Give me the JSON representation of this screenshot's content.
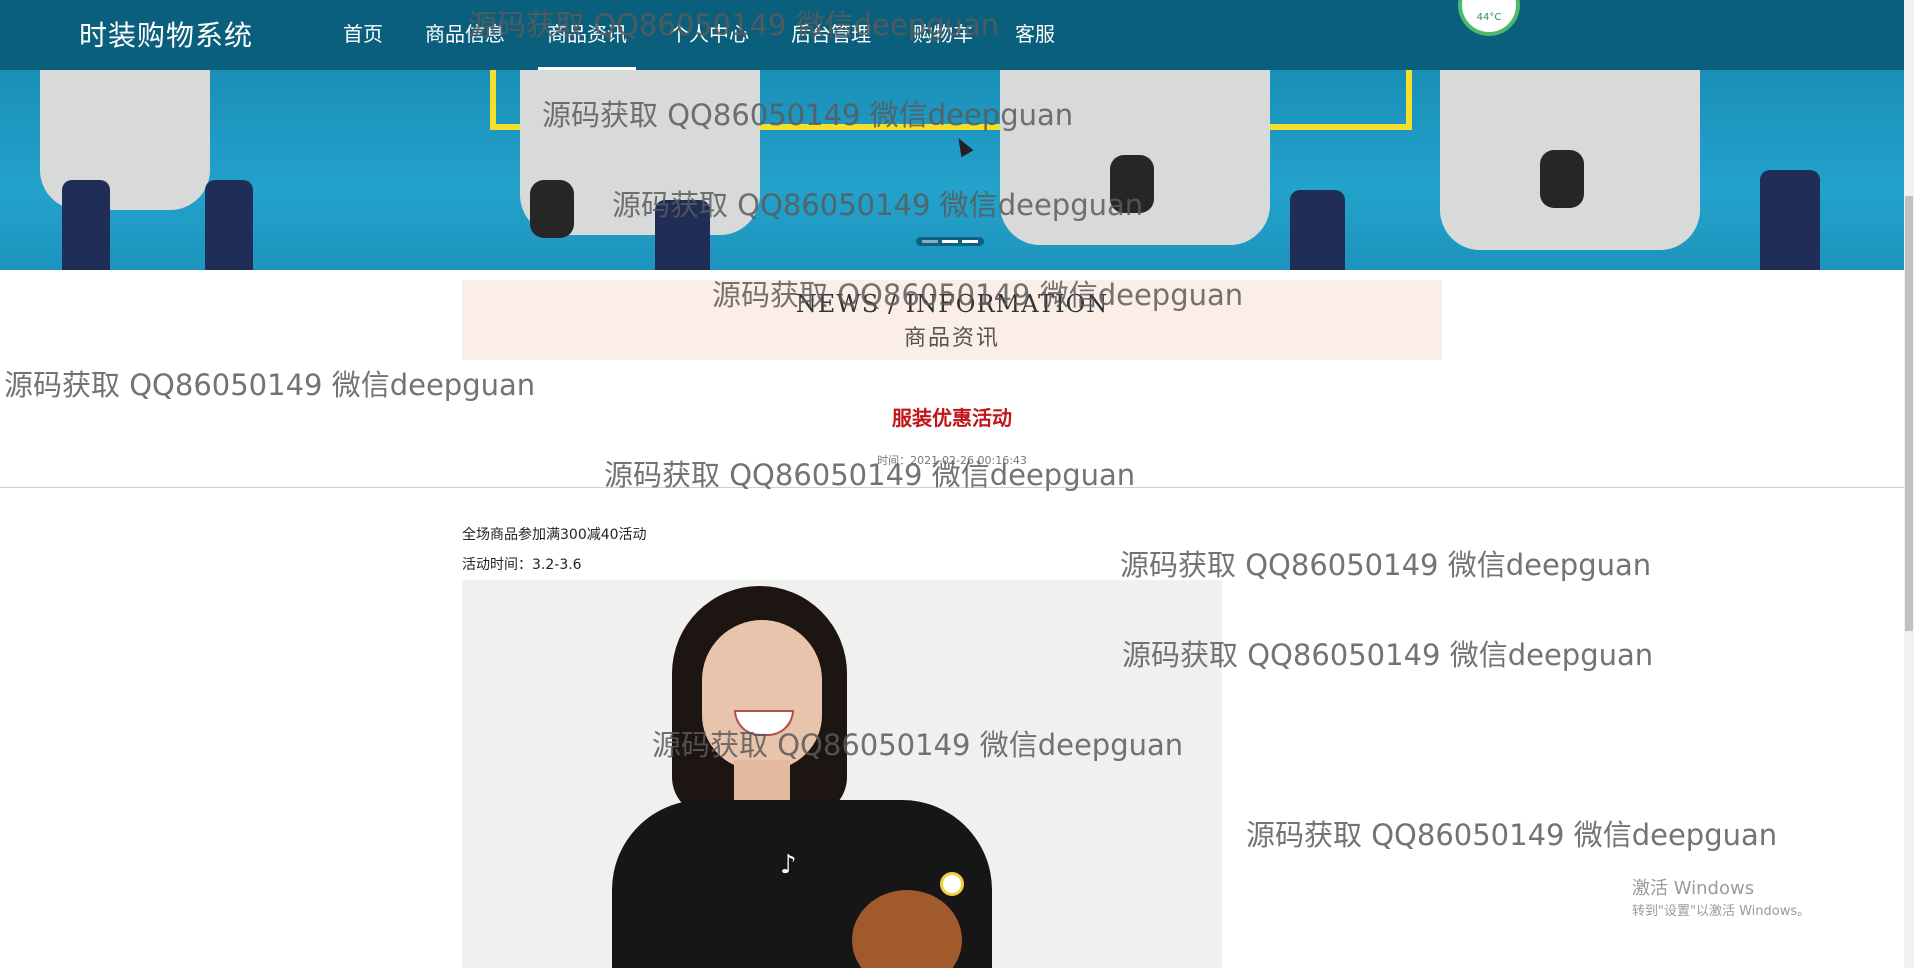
{
  "header": {
    "brand": "时装购物系统",
    "nav": [
      {
        "label": "首页",
        "active": false
      },
      {
        "label": "商品信息",
        "active": false
      },
      {
        "label": "商品资讯",
        "active": true
      },
      {
        "label": "个人中心",
        "active": false
      },
      {
        "label": "后台管理",
        "active": false
      },
      {
        "label": "购物车",
        "active": false
      },
      {
        "label": "客服",
        "active": false
      }
    ],
    "widget_temp": "44°C"
  },
  "banner": {
    "dots_count": 3,
    "active_dot": 2
  },
  "news": {
    "en_title": "NEWS / INFORMATION",
    "cn_title": "商品资讯"
  },
  "article": {
    "title": "服装优惠活动",
    "time": "时间：2021-02-26 00:16:43",
    "paragraph1": "全场商品参加满300减40活动",
    "paragraph2": "活动时间：3.2-3.6"
  },
  "watermark": {
    "text": "源码获取 QQ86050149 微信deepguan"
  },
  "system": {
    "activate_title": "激活 Windows",
    "activate_sub": "转到\"设置\"以激活 Windows。"
  },
  "colors": {
    "nav_bg": "#0a5f7c",
    "title_red": "#c0161a",
    "news_bg": "#fbeee6"
  }
}
